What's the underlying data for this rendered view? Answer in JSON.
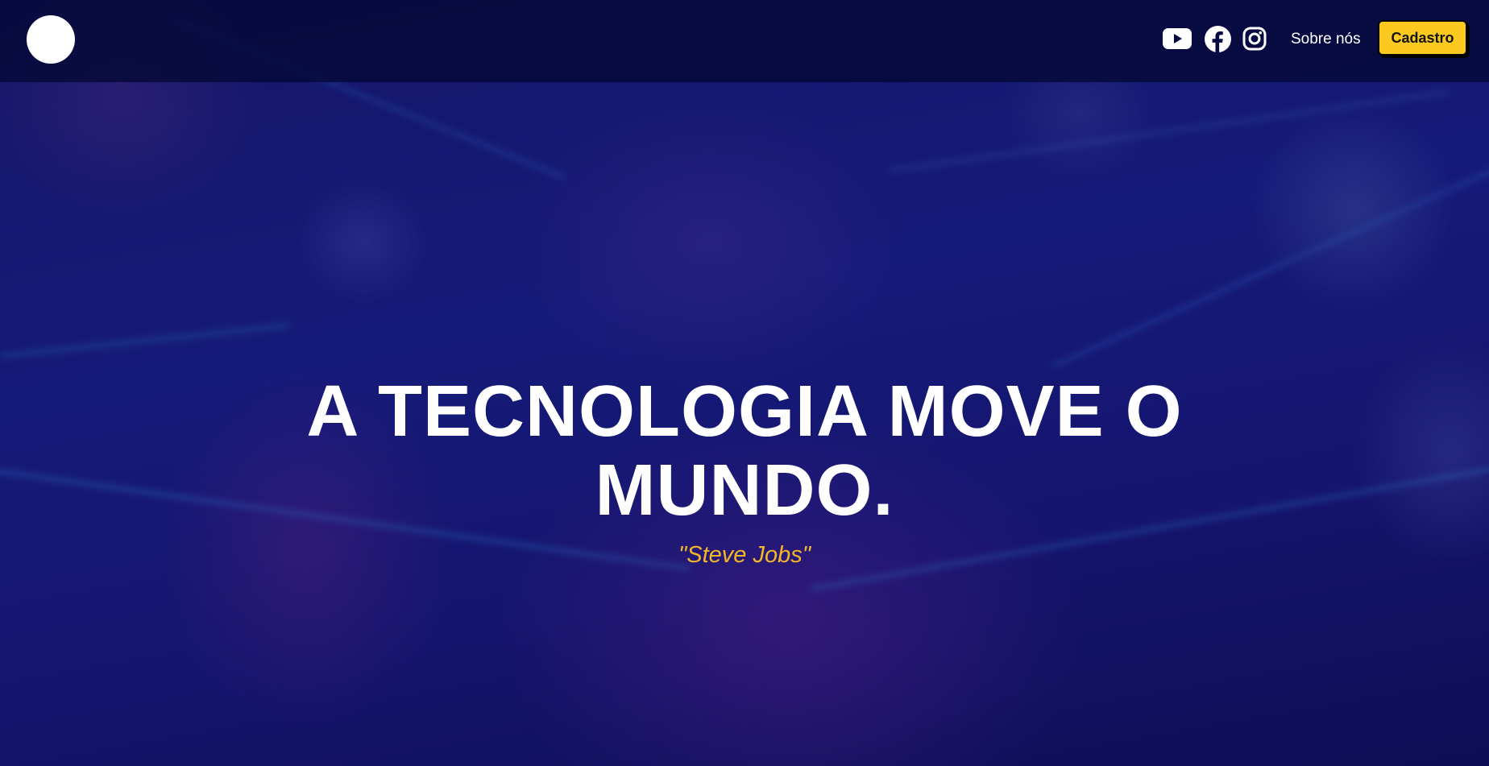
{
  "header": {
    "social_links": [
      {
        "name": "youtube-icon",
        "label": "YouTube"
      },
      {
        "name": "facebook-icon",
        "label": "Facebook"
      },
      {
        "name": "instagram-icon",
        "label": "Instagram"
      }
    ],
    "nav_about_label": "Sobre nós",
    "cta_label": "Cadastro"
  },
  "hero": {
    "title": "A TECNOLOGIA MOVE O MUNDO.",
    "quote": "\"Steve Jobs\""
  },
  "colors": {
    "header_bg": "#04083a",
    "accent_yellow": "#fbc91f",
    "quote_color": "#f2b729",
    "text_white": "#ffffff"
  }
}
